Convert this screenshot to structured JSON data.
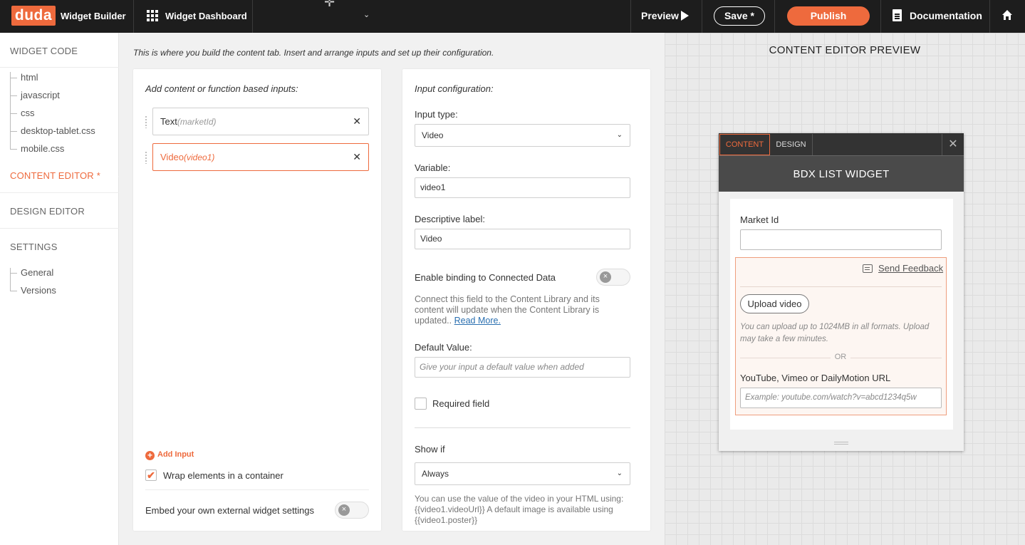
{
  "topbar": {
    "logo": "duda",
    "brand": "Widget Builder",
    "dashboard": "Widget Dashboard",
    "preview": "Preview",
    "save": "Save *",
    "publish": "Publish",
    "documentation": "Documentation",
    "accent": "#ee6a3d"
  },
  "nav": {
    "widget_code": "WIDGET CODE",
    "files": [
      "html",
      "javascript",
      "css",
      "desktop-tablet.css",
      "mobile.css"
    ],
    "content_editor": "CONTENT EDITOR *",
    "design_editor": "DESIGN EDITOR",
    "settings": "SETTINGS",
    "settings_items": [
      "General",
      "Versions"
    ]
  },
  "main": {
    "intro": "This is where you build the content tab. Insert and arrange inputs and set up their configuration.",
    "inputs_title": "Add content or function based inputs:",
    "inputs": [
      {
        "name": "Text",
        "var": "(marketId)"
      },
      {
        "name": "Video",
        "var": "(video1)"
      }
    ],
    "add_input": "Add Input",
    "wrap_label": "Wrap elements in a container",
    "wrap_checked": true,
    "embed_label": "Embed your own external widget settings",
    "embed_on": false
  },
  "config": {
    "title": "Input configuration:",
    "input_type_label": "Input type:",
    "input_type_value": "Video",
    "variable_label": "Variable:",
    "variable_value": "video1",
    "desc_label": "Descriptive label:",
    "desc_value": "Video",
    "binding_label": "Enable binding to Connected Data",
    "binding_on": false,
    "binding_note": "Connect this field to the Content Library and its content will update when the Content Library is updated..",
    "read_more": "Read More.",
    "default_label": "Default Value:",
    "default_placeholder": "Give your input a default value when added",
    "required_label": "Required field",
    "show_if_label": "Show if",
    "show_if_value": "Always",
    "usage_note": "You can use the value of the video in your HTML using: {{video1.videoUrl}} A default image is available using {{video1.poster}}"
  },
  "preview": {
    "title": "CONTENT EDITOR PREVIEW",
    "tab_content": "CONTENT",
    "tab_design": "DESIGN",
    "widget_title": "BDX LIST WIDGET",
    "market_label": "Market Id",
    "feedback": "Send Feedback",
    "upload_button": "Upload video",
    "upload_note": "You can upload up to 1024MB in all formats. Upload may take a few minutes.",
    "or": "OR",
    "url_label": "YouTube, Vimeo or DailyMotion URL",
    "url_placeholder": "Example: youtube.com/watch?v=abcd1234q5w"
  }
}
